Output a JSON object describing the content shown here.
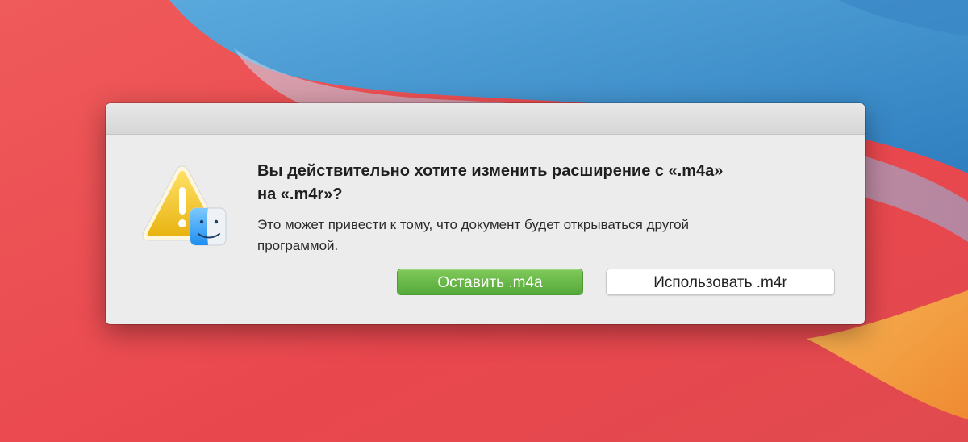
{
  "alert": {
    "icon": "warning-triangle-with-finder-badge",
    "message_line1": "Вы действительно хотите изменить расширение с «.m4a»",
    "message_line2": "на «.m4r»?",
    "informative_line1": "Это может привести к тому, что документ будет открываться другой",
    "informative_line2": "программой.",
    "buttons": {
      "keep_label": "Оставить .m4a",
      "use_label": "Использовать .m4r"
    }
  },
  "colors": {
    "default_button": "#5db33f",
    "dialog_background": "#ececec",
    "warning_yellow": "#f2c21b"
  }
}
